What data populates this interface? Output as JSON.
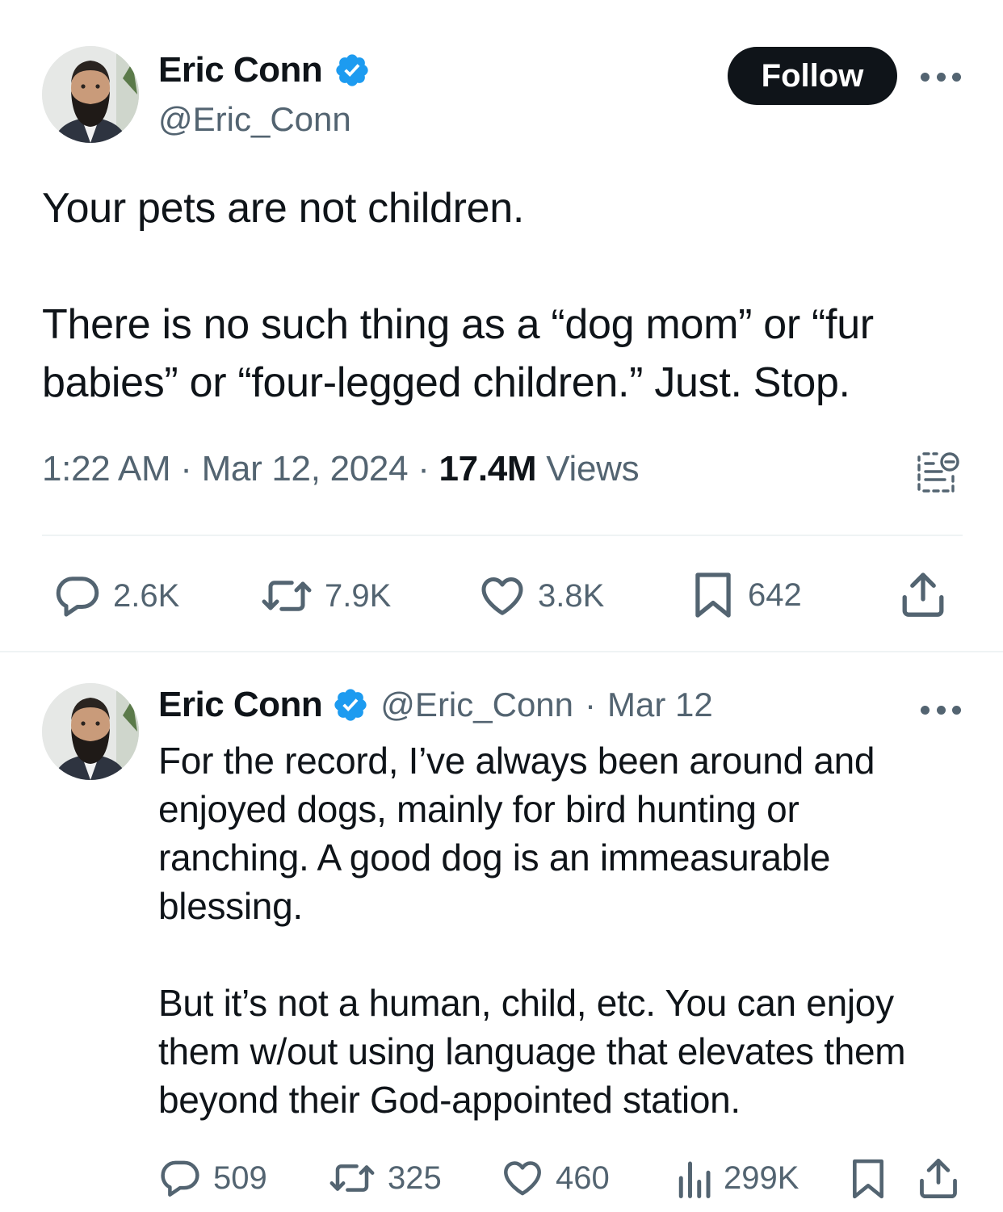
{
  "tweet": {
    "author": {
      "name": "Eric Conn",
      "handle": "@Eric_Conn"
    },
    "follow_label": "Follow",
    "text_paragraphs": [
      "Your pets are not children.",
      "There is no such thing as a “dog mom” or “fur babies” or “four-legged children.” Just. Stop."
    ],
    "time": "1:22 AM",
    "date": "Mar 12, 2024",
    "views_count": "17.4M",
    "views_label": "Views",
    "separator": "·",
    "stats": {
      "replies": "2.6K",
      "reposts": "7.9K",
      "likes": "3.8K",
      "bookmarks": "642"
    }
  },
  "reply": {
    "author": {
      "name": "Eric Conn",
      "handle": "@Eric_Conn"
    },
    "date": "Mar 12",
    "separator": "·",
    "text_paragraphs": [
      "For the record, I’ve always been around and enjoyed dogs, mainly for bird hunting or ranching. A good dog is an immeasurable blessing.",
      "But it’s not a human, child, etc. You can enjoy them w/out using language that elevates them beyond their God-appointed station."
    ],
    "stats": {
      "replies": "509",
      "reposts": "325",
      "likes": "460",
      "views": "299K"
    }
  },
  "colors": {
    "text_primary": "#0f1419",
    "text_secondary": "#536471",
    "verified_blue": "#1d9bf0",
    "divider": "#eff3f4",
    "follow_bg": "#0f1419"
  },
  "icons": [
    "avatar",
    "verified-badge-icon",
    "more-icon",
    "analytics-icon",
    "reply-icon",
    "repost-icon",
    "like-icon",
    "bookmark-icon",
    "share-icon",
    "views-icon"
  ]
}
